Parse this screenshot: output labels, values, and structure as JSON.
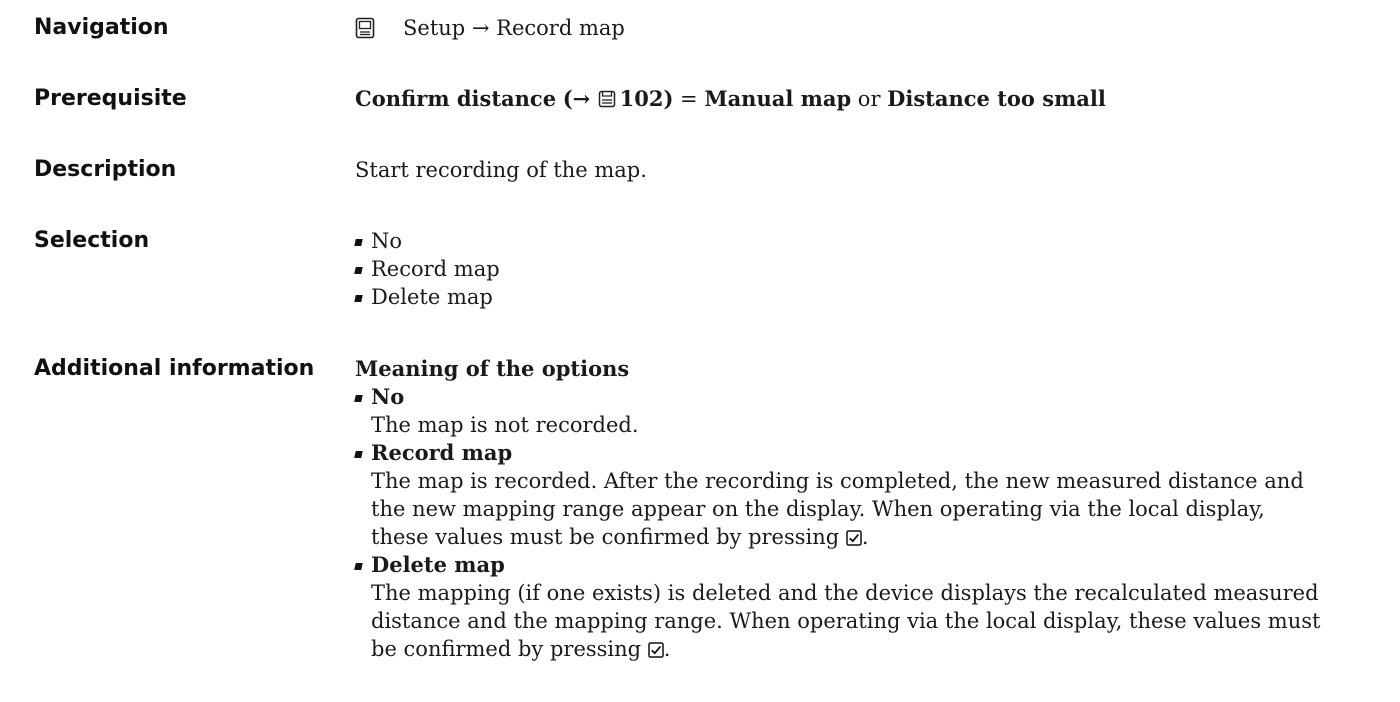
{
  "navigation": {
    "label": "Navigation",
    "path": "Setup → Record map"
  },
  "prerequisite": {
    "label": "Prerequisite",
    "param": "Confirm distance",
    "ref_open": "(→ ",
    "page": "102",
    "ref_close": ")",
    "eq": " = ",
    "opt1": "Manual map",
    "or": " or ",
    "opt2": "Distance too small"
  },
  "description": {
    "label": "Description",
    "text": "Start recording of the map."
  },
  "selection": {
    "label": "Selection",
    "items": [
      "No",
      "Record map",
      "Delete map"
    ]
  },
  "additional": {
    "label": "Additional information",
    "heading": "Meaning of the options",
    "options": [
      {
        "name": "No",
        "text": "The map is not recorded."
      },
      {
        "name": "Record map",
        "line1": "The map is recorded. After the recording is completed, the new measured distance and",
        "line2": "the new mapping range appear on the display. When operating via the local display,",
        "line3": "these values must be confirmed by pressing",
        "end": "."
      },
      {
        "name": "Delete map",
        "line1": "The mapping (if one exists) is deleted and the device displays the recalculated measured",
        "line2": "distance and the mapping range. When operating via the local display, these values must",
        "line3": "be confirmed by pressing",
        "end": "."
      }
    ]
  },
  "icons": {
    "navigation": "display-icon",
    "page_ref": "document-page-icon",
    "enter_key": "checkbox-enter-icon"
  }
}
